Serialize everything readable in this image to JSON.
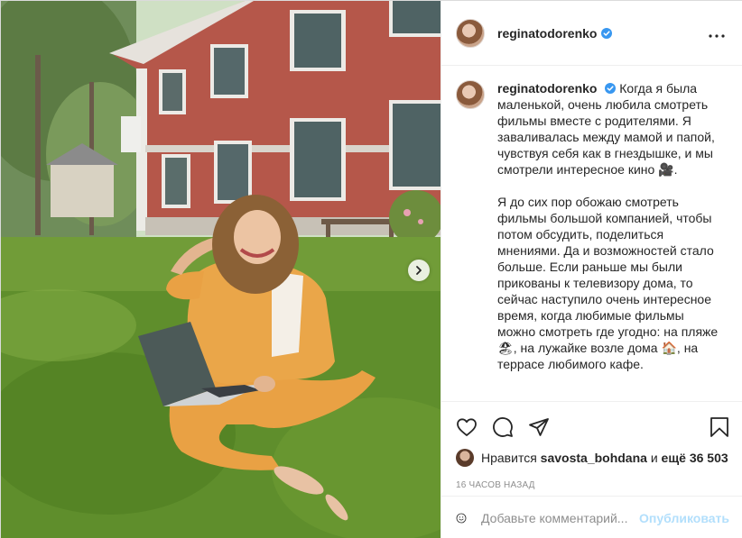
{
  "post": {
    "username": "reginatodorenko",
    "verified": true,
    "caption_paragraphs": [
      "Когда я была маленькой, очень любила смотреть фильмы вместе с родителями. Я заваливалась между мамой и папой, чувствуя себя как в гнездышке, и мы смотрели интересное кино 🎥.",
      "Я до сих пор обожаю смотреть фильмы большой компанией, чтобы потом обсудить, поделиться мнениями. Да и возможностей стало больше. Если раньше мы были прикованы к телевизору дома, то сейчас наступило очень интересное время, когда любимые фильмы можно смотреть где угодно: на пляже 🏖, на лужайке возле дома 🏠, на террасе любимого кафе."
    ],
    "likes": {
      "prefix": "Нравится",
      "user": "savosta_bohdana",
      "connector": "и",
      "others": "ещё 36 503"
    },
    "timestamp": "16 ЧАСОВ НАЗАД",
    "comment_placeholder": "Добавьте комментарий...",
    "publish_label": "Опубликовать"
  },
  "icons": {
    "like": "heart-icon",
    "comment": "comment-bubble-icon",
    "share": "paper-plane-icon",
    "save": "bookmark-icon",
    "more": "more-dots-icon",
    "next": "chevron-right-icon",
    "emoji": "smiley-icon",
    "verified": "verified-badge-icon"
  },
  "colors": {
    "verified_blue": "#3897f0",
    "publish_disabled": "#b2dffc",
    "muted_text": "#8e8e8e"
  }
}
